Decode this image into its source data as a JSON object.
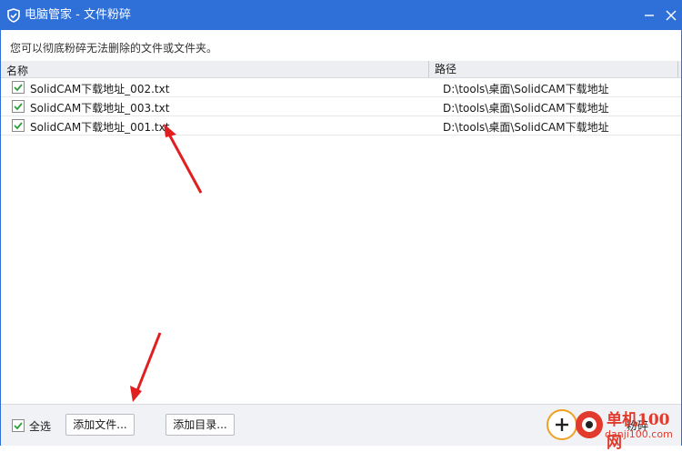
{
  "window": {
    "title": "电脑管家 - 文件粉碎"
  },
  "description": "您可以彻底粉碎无法删除的文件或文件夹。",
  "table": {
    "columns": [
      "名称",
      "路径"
    ],
    "rows": [
      {
        "checked": true,
        "name": "SolidCAM下载地址_002.txt",
        "path": "D:\\tools\\桌面\\SolidCAM下载地址"
      },
      {
        "checked": true,
        "name": "SolidCAM下载地址_003.txt",
        "path": "D:\\tools\\桌面\\SolidCAM下载地址"
      },
      {
        "checked": true,
        "name": "SolidCAM下载地址_001.txt",
        "path": "D:\\tools\\桌面\\SolidCAM下载地址"
      }
    ]
  },
  "footer": {
    "select_all": "全选",
    "add_file": "添加文件...",
    "add_dir": "添加目录...",
    "shred": "粉碎"
  },
  "watermark": {
    "line1": "单机100网",
    "line2": "danji100.com"
  },
  "colors": {
    "titlebar": "#2f6fd8",
    "check": "#2f9e3a",
    "arrow": "#e02020"
  },
  "icons": {
    "app": "shield-icon",
    "minimize": "minimize-icon",
    "close": "close-icon",
    "check": "checkmark-icon"
  }
}
